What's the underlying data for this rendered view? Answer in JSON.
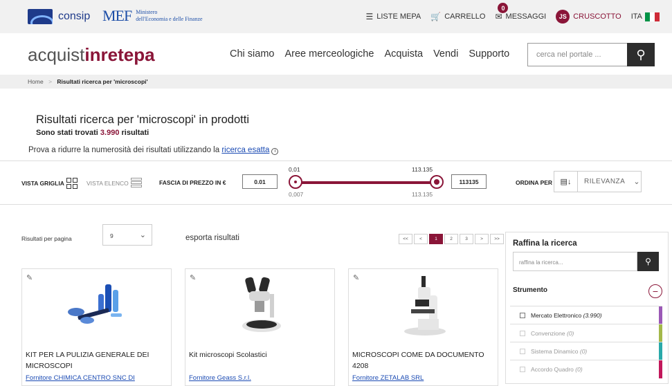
{
  "topbar": {
    "consip": "consip",
    "mef": "MEF",
    "mef_line1": "Ministero",
    "mef_line2": "dell'Economia e delle Finanze",
    "nav": [
      {
        "icon": "menu-icon",
        "label": "LISTE MEPA"
      },
      {
        "icon": "cart-icon",
        "label": "CARRELLO"
      },
      {
        "icon": "mail-icon",
        "label": "MESSAGGI",
        "badge": "0"
      },
      {
        "icon": "avatar",
        "avatar": "JS",
        "label": "CRUSCOTTO"
      },
      {
        "label": "ITA"
      }
    ],
    "flag_colors": [
      "#009246",
      "#ffffff",
      "#ce2b37"
    ]
  },
  "header": {
    "brand_a": "acquist",
    "brand_b": "inrete",
    "brand_c": "pa",
    "nav": [
      "Chi siamo",
      "Aree merceologiche",
      "Acquista",
      "Vendi",
      "Supporto"
    ],
    "search_placeholder": "cerca nel portale ..."
  },
  "breadcrumb": {
    "home": "Home",
    "sep": ">",
    "current": "Risultati ricerca per 'microscopi'"
  },
  "results": {
    "title": "Risultati ricerca per 'microscopi' in prodotti",
    "count_pre": "Sono stati trovati",
    "count": "3.990",
    "count_post": "risultati",
    "hint_pre": "Prova a ridurre la numerosità dei risultati utilizzando la",
    "hint_link": "ricerca esatta",
    "info": "i"
  },
  "filters": {
    "grid_view": "VISTA GRIGLIA",
    "list_view": "VISTA ELENCO",
    "price_label": "FASCIA DI PREZZO IN €",
    "min_value": "0.01",
    "max_value": "113135",
    "slider_min_sel": "0,01",
    "slider_max_sel": "113.135",
    "slider_min": "0,007",
    "slider_max": "113.135",
    "order_label": "ORDINA PER",
    "order_value": "RILEVANZA"
  },
  "listing": {
    "per_page_label": "Risultati per pagina",
    "per_page_value": "9",
    "export": "esporta risultati",
    "pager": [
      "<<",
      "<",
      "1",
      "2",
      "3",
      ">",
      ">>"
    ],
    "pager_active": 2
  },
  "refine": {
    "title": "Raffina la ricerca",
    "placeholder": "raffina la ricerca...",
    "section": "Strumento",
    "options": [
      {
        "label": "Mercato Elettronico",
        "count": "(3.990)",
        "color": "#9b59b6",
        "enabled": true
      },
      {
        "label": "Convenzione",
        "count": "(0)",
        "color": "#a3b84a",
        "enabled": false
      },
      {
        "label": "Sistema Dinamico",
        "count": "(0)",
        "color": "#2aa9a9",
        "enabled": false
      },
      {
        "label": "Accordo Quadro",
        "count": "(0)",
        "color": "#c2185b",
        "enabled": false
      }
    ]
  },
  "products": [
    {
      "name": "KIT PER LA PULIZIA GENERALE DEI MICROSCOPI",
      "supplier": "Fornitore CHIMICA CENTRO SNC DI"
    },
    {
      "name": "Kit microscopi Scolastici",
      "supplier": "Fornitore Geass S.r.l."
    },
    {
      "name": "MICROSCOPI COME DA DOCUMENTO 4208",
      "supplier": "Fornitore ZETALAB SRL"
    }
  ],
  "colors": {
    "accent": "#8a1538",
    "link": "#1a4ab3",
    "dark": "#2d2d2d"
  }
}
